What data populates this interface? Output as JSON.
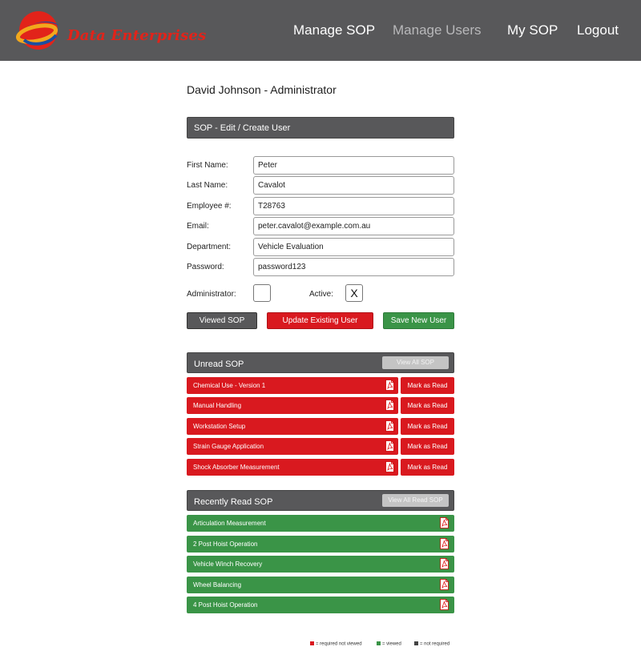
{
  "header": {
    "brand": "Data Enterprises",
    "nav": [
      {
        "label": "Manage SOP"
      },
      {
        "label": "Manage Users"
      },
      {
        "label": "My SOP"
      },
      {
        "label": "Logout"
      }
    ]
  },
  "user": {
    "title": "David Johnson - Administrator"
  },
  "form": {
    "heading": "SOP - Edit / Create User",
    "fields": [
      {
        "label": "First Name:",
        "value": "Peter"
      },
      {
        "label": "Last Name:",
        "value": "Cavalot"
      },
      {
        "label": "Employee #:",
        "value": "T28763"
      },
      {
        "label": "Email:",
        "value": "peter.cavalot@example.com.au"
      },
      {
        "label": "Department:",
        "value": "Vehicle Evaluation"
      },
      {
        "label": "Password:",
        "value": "password123"
      }
    ],
    "administrator_label": "Administrator:",
    "administrator_value": "",
    "active_label": "Active:",
    "active_value": "X",
    "buttons": {
      "viewed": "Viewed SOP",
      "update": "Update Existing User",
      "save": "Save New User"
    }
  },
  "unread": {
    "heading": "Unread SOP",
    "view_all": "View All SOP",
    "mark_label": "Mark as Read",
    "items": [
      {
        "title": "Chemical Use - Version 1"
      },
      {
        "title": "Manual Handling"
      },
      {
        "title": "Workstation Setup"
      },
      {
        "title": "Strain Gauge Application"
      },
      {
        "title": "Shock Absorber Measurement"
      }
    ]
  },
  "recent": {
    "heading": "Recently Read SOP",
    "view_all": "View All Read SOP",
    "items": [
      {
        "title": "Articulation Measurement"
      },
      {
        "title": "2 Post Hoist Operation"
      },
      {
        "title": "Vehicle Winch Recovery"
      },
      {
        "title": "Wheel Balancing"
      },
      {
        "title": "4 Post Hoist Operation"
      }
    ]
  },
  "legend": {
    "required_not_viewed": "= required not viewed",
    "viewed": "= viewed",
    "not_required": "= not required"
  },
  "colors": {
    "header_bg": "#58585a",
    "brand_red": "#d9191f",
    "viewed_green": "#3a9447"
  }
}
